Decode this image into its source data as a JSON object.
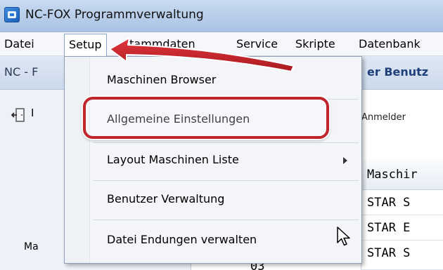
{
  "window": {
    "title": "NC-FOX Programmverwaltung"
  },
  "menubar": {
    "items": [
      {
        "label": "Datei"
      },
      {
        "label": "Setup"
      },
      {
        "label": "Stammdaten"
      },
      {
        "label": "Service"
      },
      {
        "label": "Skripte"
      },
      {
        "label": "Datenbank"
      }
    ]
  },
  "subheader": {
    "left_text": "NC - F",
    "right_text": "er Benutz"
  },
  "left_panel": {
    "button_partial": "I",
    "bottom_label": "Ma"
  },
  "toolbar": {
    "login_label": "Anmelder"
  },
  "table": {
    "header": "Maschir",
    "rows": [
      "STAR S",
      "STAR E",
      "STAR S"
    ],
    "row_number_partial": "03"
  },
  "dropdown": {
    "items": [
      {
        "label": "Maschinen Browser"
      },
      {
        "label": "Allgemeine Einstellungen"
      },
      {
        "label": "Layout Maschinen Liste",
        "has_submenu": true
      },
      {
        "label": "Benutzer Verwaltung"
      },
      {
        "label": "Datei Endungen verwalten"
      }
    ]
  },
  "colors": {
    "annotation_red": "#c0252c",
    "accent": "#1f3f78"
  }
}
